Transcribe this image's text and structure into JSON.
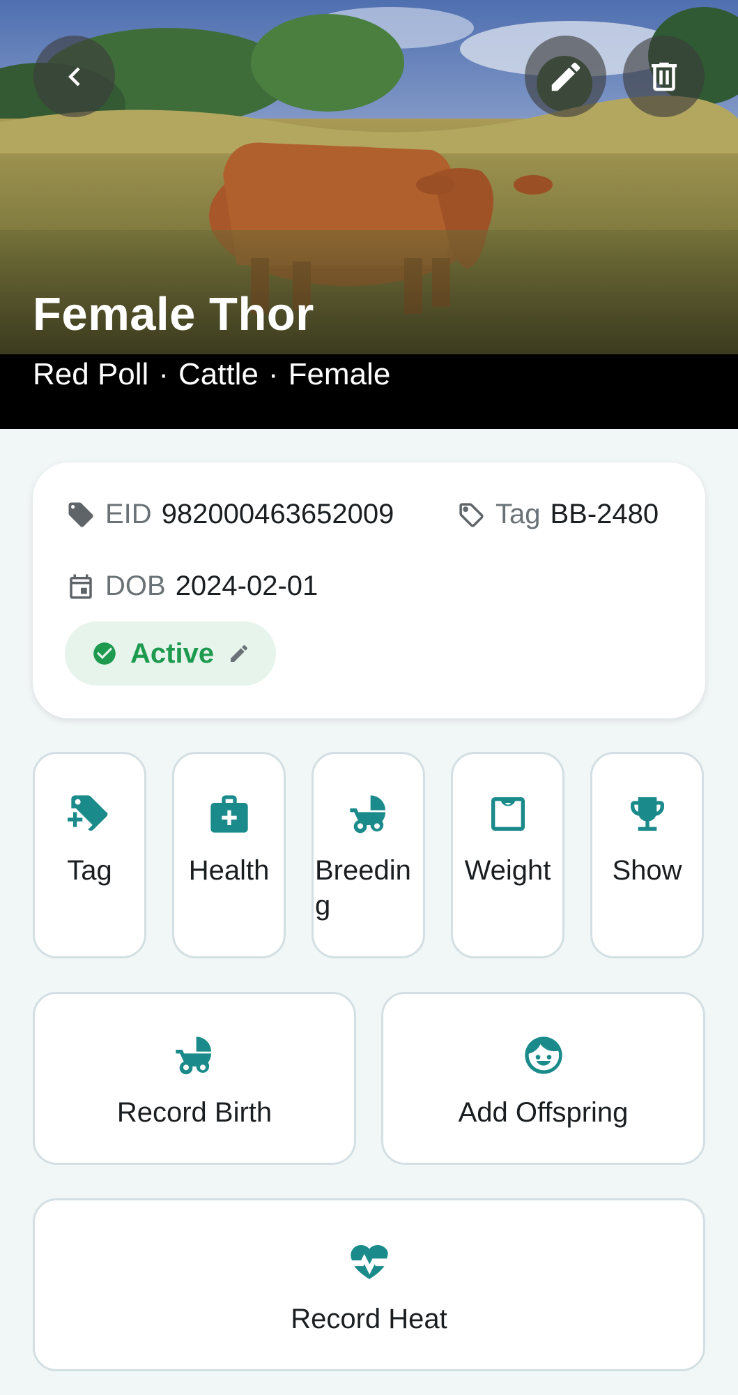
{
  "header": {
    "title": "Female Thor",
    "subtitle_parts": [
      "Red Poll",
      "Cattle",
      "Female"
    ],
    "separator": "·",
    "back_icon": "chevron-left-icon",
    "edit_icon": "pencil-icon",
    "delete_icon": "trash-icon"
  },
  "info": {
    "eid_label": "EID",
    "eid_value": "982000463652009",
    "tag_label": "Tag",
    "tag_value": "BB-2480",
    "dob_label": "DOB",
    "dob_value": "2024-02-01",
    "status": "Active",
    "status_color": "#1e9a4f"
  },
  "actions": [
    {
      "label": "Tag",
      "icon": "tag-plus-icon"
    },
    {
      "label": "Health",
      "icon": "medical-bag-icon"
    },
    {
      "label": "Breeding",
      "icon": "baby-carriage-icon"
    },
    {
      "label": "Weight",
      "icon": "weight-icon"
    },
    {
      "label": "Show",
      "icon": "trophy-icon"
    }
  ],
  "wide_actions": [
    {
      "label": "Record Birth",
      "icon": "baby-carriage-icon"
    },
    {
      "label": "Add Offspring",
      "icon": "baby-face-icon"
    },
    {
      "label": "Record Heat",
      "icon": "heart-pulse-icon"
    }
  ],
  "colors": {
    "accent": "#1a8a8a",
    "background": "#f1f6f7",
    "active_chip_bg": "#e6f4ec"
  }
}
